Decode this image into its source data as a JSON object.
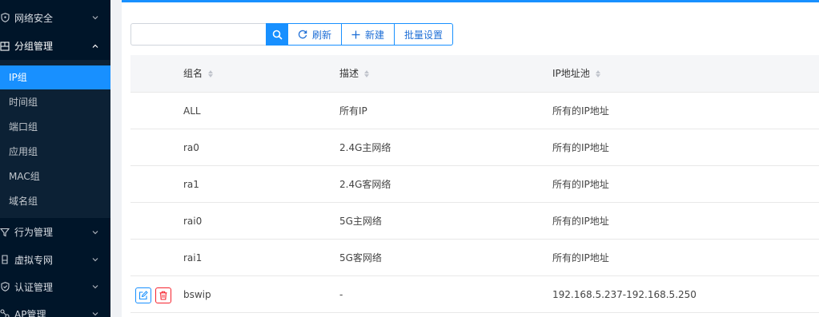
{
  "sidebar": {
    "menus": [
      {
        "label": "网络安全",
        "icon": "shield-icon"
      },
      {
        "label": "分组管理",
        "icon": "group-icon"
      },
      {
        "label": "行为管理",
        "icon": "filter-icon"
      },
      {
        "label": "虚拟专网",
        "icon": "vpn-icon"
      },
      {
        "label": "认证管理",
        "icon": "shield-check-icon"
      },
      {
        "label": "AP管理",
        "icon": "ap-icon"
      }
    ],
    "sub_items": [
      "IP组",
      "时间组",
      "端口组",
      "应用组",
      "MAC组",
      "域名组"
    ],
    "active_sub_item": "IP组"
  },
  "toolbar": {
    "search_value": "",
    "search_placeholder": "",
    "refresh_label": "刷新",
    "new_label": "新建",
    "batch_label": "批量设置"
  },
  "table": {
    "columns": [
      "组名",
      "描述",
      "IP地址池"
    ],
    "rows": [
      {
        "name": "ALL",
        "desc": "所有IP",
        "pool": "所有的IP地址"
      },
      {
        "name": "ra0",
        "desc": "2.4G主网络",
        "pool": "所有的IP地址"
      },
      {
        "name": "ra1",
        "desc": "2.4G客网络",
        "pool": "所有的IP地址"
      },
      {
        "name": "rai0",
        "desc": "5G主网络",
        "pool": "所有的IP地址"
      },
      {
        "name": "rai1",
        "desc": "5G客网络",
        "pool": "所有的IP地址"
      },
      {
        "name": "bswip",
        "desc": "-",
        "pool": "192.168.5.237-192.168.5.250"
      }
    ]
  },
  "colors": {
    "accent": "#1890ff",
    "danger": "#f5222d",
    "sidebar_bg": "#001529"
  }
}
